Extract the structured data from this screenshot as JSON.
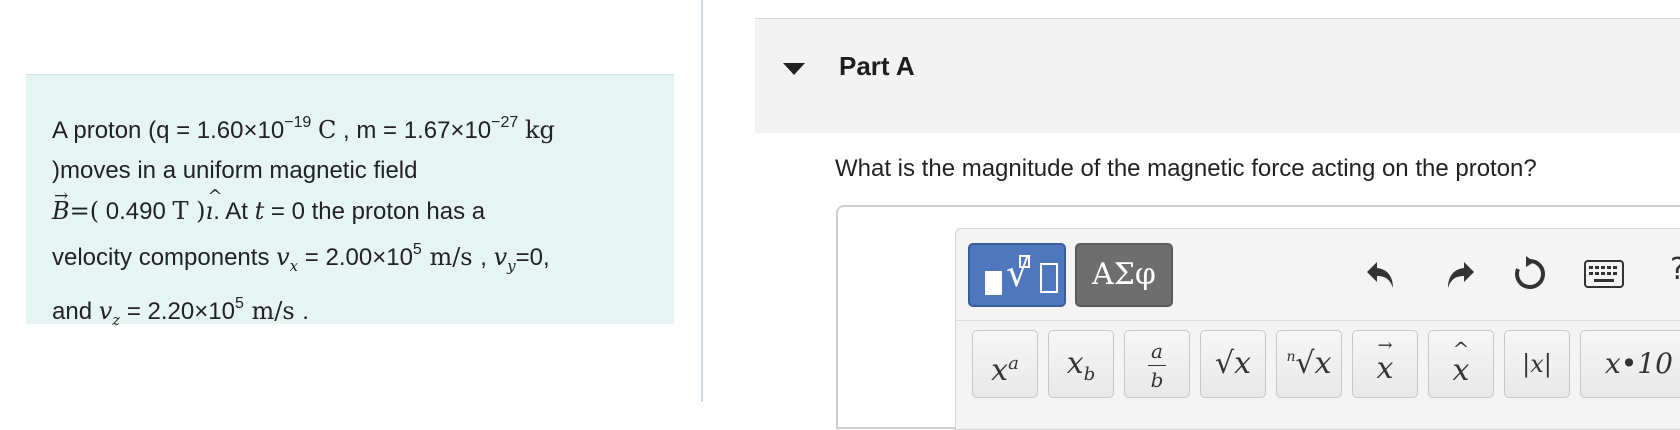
{
  "problem": {
    "line1": {
      "pre": "A proton (q = 1.60×10",
      "q_exp": "−19",
      "q_unit": "C",
      "mid": " , m = 1.67×10",
      "m_exp": "−27",
      "m_unit": "kg"
    },
    "line2": ")moves in a uniform magnetic field",
    "line3": {
      "b_symbol": "B",
      "b_eq": "=(",
      "b_value": " 0.490 ",
      "b_unit": "T",
      "b_close": " )",
      "i_hat": "ı",
      "after": ". At ",
      "t_symbol": "t",
      "t_text": " = 0 the proton has a"
    },
    "line4": {
      "pre": "velocity components ",
      "vx_symbol": "v",
      "vx_sub": "x",
      "vx_value": " = 2.00×10",
      "vx_exp": "5",
      "vx_unit": " m/s ",
      "comma": ", ",
      "vy_symbol": "v",
      "vy_sub": "y",
      "vy_value": "=0,"
    },
    "line5": {
      "pre": "and ",
      "vz_symbol": "v",
      "vz_sub": "z",
      "vz_value": " = 2.20×10",
      "vz_exp": "5",
      "vz_unit": " m/s ",
      "end": "."
    }
  },
  "part": {
    "title": "Part A",
    "question": "What is the magnitude of the magnetic force acting on the proton?"
  },
  "toolbar": {
    "greek_label": "ΑΣφ",
    "symbols": [
      {
        "name": "superscript-button",
        "base": "x",
        "sup": "a"
      },
      {
        "name": "subscript-button",
        "base": "x",
        "sub": "b"
      },
      {
        "name": "fraction-button",
        "num": "a",
        "den": "b"
      },
      {
        "name": "sqrt-button",
        "label": "√x"
      },
      {
        "name": "nth-root-button",
        "idx": "n",
        "label": "√x"
      },
      {
        "name": "vector-button",
        "label": "x",
        "mark": "→"
      },
      {
        "name": "unit-vector-button",
        "label": "x",
        "mark": "^"
      },
      {
        "name": "abs-button",
        "label": "|x|"
      },
      {
        "name": "sci-notation-button",
        "label": "x•10"
      }
    ],
    "help_label": "?"
  },
  "colors": {
    "problem_bg": "#e6f5f4",
    "templates_button": "#4f77bd",
    "greek_button": "#6e6e6e",
    "header_bg": "#f3f3f3"
  }
}
